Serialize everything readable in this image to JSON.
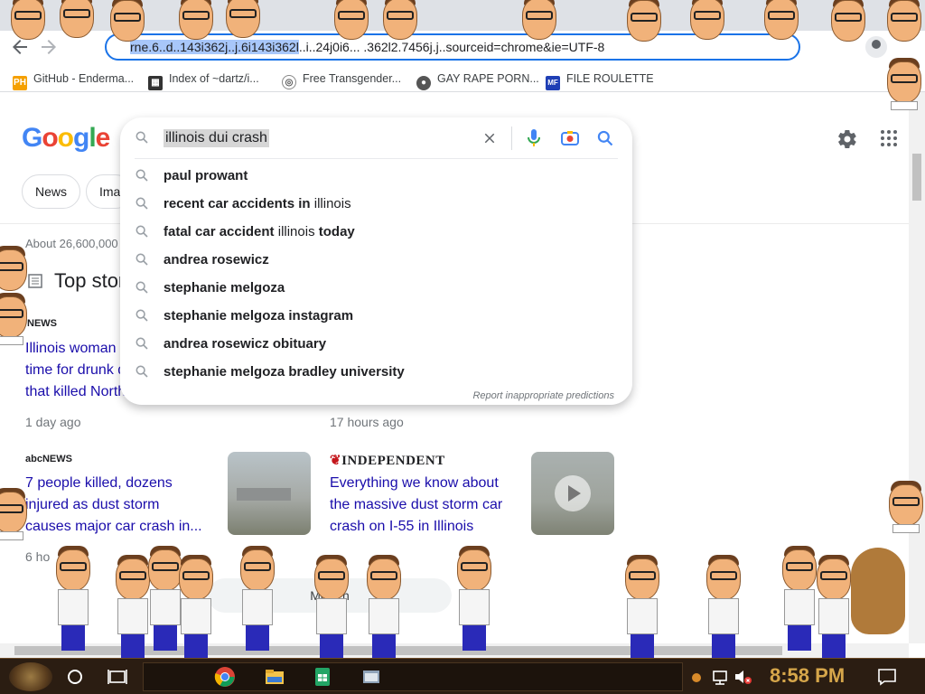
{
  "browser": {
    "url_text": "rne.6..d..143i362j..j.6i143i362l..i..24j0i6... .362l2.7456j.j..sourceid=chrome&ie=UTF-8",
    "url_selected": "rne.6..d..143i362j..j.6i143i362l",
    "url_rest": "..i..24j0i6... .362l2.7456j.j..sourceid=chrome&ie=UTF-8"
  },
  "bookmarks": [
    {
      "label": "GitHub - Enderma...",
      "icon": "ph-icon",
      "color": "#f5a000"
    },
    {
      "label": "Index of ~dartz/i...",
      "icon": "folder-icon",
      "color": "#333333"
    },
    {
      "label": "Free Transgender...",
      "icon": "globe-icon",
      "color": "#666666"
    },
    {
      "label": "GAY RAPE PORN...",
      "icon": "globe-icon",
      "color": "#555555"
    },
    {
      "label": "FILE ROULETTE",
      "icon": "mf-icon",
      "color": "#1f3fb5"
    }
  ],
  "google": {
    "logo": [
      "G",
      "o",
      "o",
      "g",
      "l",
      "e"
    ],
    "search_query": "illinois dui crash",
    "chips": [
      "News",
      "Ima"
    ],
    "results_count": "About 26,600,000",
    "top_stories": "Top stor"
  },
  "suggestions": [
    {
      "bold": "paul prowant",
      "rest": ""
    },
    {
      "bold": "recent car accidents in",
      "rest": " illinois"
    },
    {
      "bold": "fatal car accident",
      "rest": " illinois ",
      "bold2": "today"
    },
    {
      "bold": "andrea rosewicz",
      "rest": ""
    },
    {
      "bold": "stephanie melgoza",
      "rest": ""
    },
    {
      "bold": "stephanie melgoza instagram",
      "rest": ""
    },
    {
      "bold": "andrea rosewicz obituary",
      "rest": ""
    },
    {
      "bold": "stephanie melgoza bradley university",
      "rest": ""
    }
  ],
  "report_link": "Report inappropriate predictions",
  "stories": [
    {
      "source": "NEWS",
      "title_lines": [
        "Illinois woman",
        "time for drunk d",
        "that killed North"
      ],
      "time": "1 day ago"
    },
    {
      "source": "",
      "title_lines": [],
      "time": "17 hours ago"
    },
    {
      "source": "abcNEWS",
      "title_lines": [
        "7 people killed, dozens",
        "injured as dust storm",
        "causes major car crash in..."
      ],
      "time": "6 ho"
    },
    {
      "source": "INDEPENDENT",
      "title_lines": [
        "Everything we know about",
        "the massive dust storm car",
        "crash on I-55 in Illinois"
      ],
      "time": ""
    }
  ],
  "more_news": "More n",
  "taskbar": {
    "clock": "8:58 PM"
  },
  "colors": {
    "link": "#1a0dab",
    "accent": "#1a73e8",
    "taskbar": "#2b1d12",
    "clock": "#d6a64a"
  }
}
